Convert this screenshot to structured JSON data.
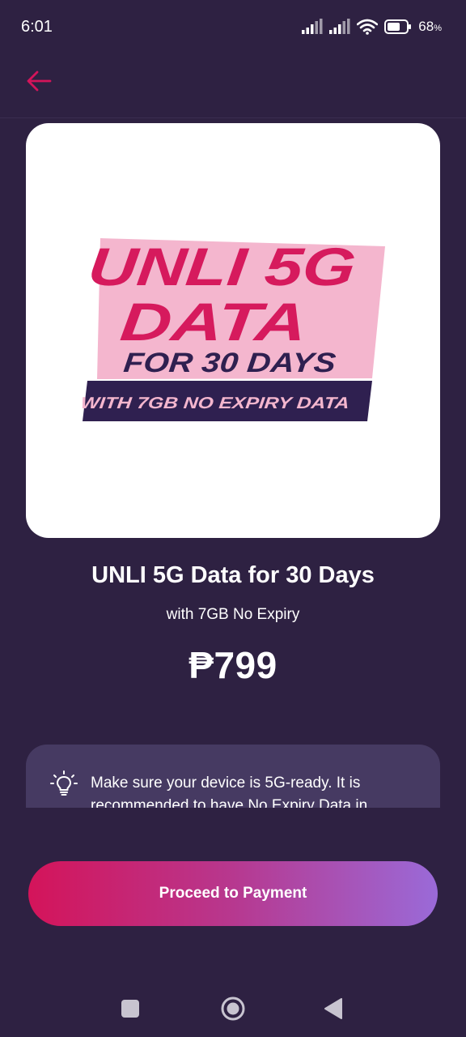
{
  "status_bar": {
    "time": "6:01",
    "battery_percent": "68",
    "battery_suffix": "%",
    "battery_level": 0.68,
    "icons": [
      "signal-icon",
      "signal-icon",
      "wifi-icon",
      "battery-icon"
    ]
  },
  "header": {
    "back_icon": "arrow-left-icon"
  },
  "banner": {
    "line1": "UNLI 5G",
    "line2": "DATA",
    "line3": "FOR 30 DAYS",
    "line4": "WITH 7GB NO EXPIRY DATA"
  },
  "product": {
    "title": "UNLI 5G Data for 30 Days",
    "subtitle": "with 7GB No Expiry",
    "price": "₱799"
  },
  "info": {
    "icon": "lightbulb-icon",
    "text": "Make sure your device is 5G-ready. It is recommended to have No Expiry Data in"
  },
  "actions": {
    "proceed_label": "Proceed to Payment"
  },
  "nav": {
    "recent_icon": "square-icon",
    "home_icon": "circle-icon",
    "back_icon": "triangle-back-icon"
  },
  "colors": {
    "background": "#2e2142",
    "accent_magenta": "#d4145a",
    "accent_purple": "#9a6ad8",
    "banner_pink": "#f4b6ce",
    "banner_red": "#d61a5d",
    "banner_navy": "#2f2050",
    "info_card": "#463a62"
  }
}
